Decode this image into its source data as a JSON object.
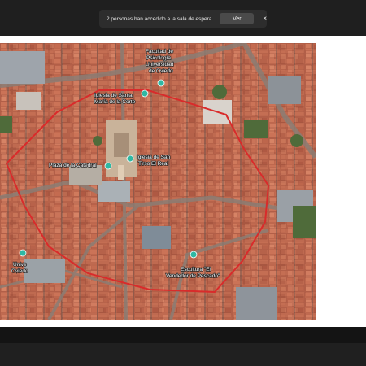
{
  "notification": {
    "message": "2 personas han accedido a la sala de espera",
    "view_label": "Ver",
    "close_glyph": "×"
  },
  "map": {
    "labels": {
      "faculty_line1": "Facultad de",
      "faculty_line2": "Psicología",
      "faculty_line3": "Universidad",
      "faculty_line4": "de Oviedo",
      "church_line1": "Iglesia de Santa",
      "church_line2": "María de la Corte",
      "plaza": "Plaza de la Catedral",
      "tirso_line1": "Iglesia de San",
      "tirso_line2": "Tirso El Real",
      "univ_line1": "Unive",
      "univ_line2": "Oviedo",
      "statue_line1": "Escultura \"El",
      "statue_line2": "Vendedor de Pescado\""
    },
    "boundary_color": "#d92b2b",
    "pin_color": "#2fb8a3"
  }
}
